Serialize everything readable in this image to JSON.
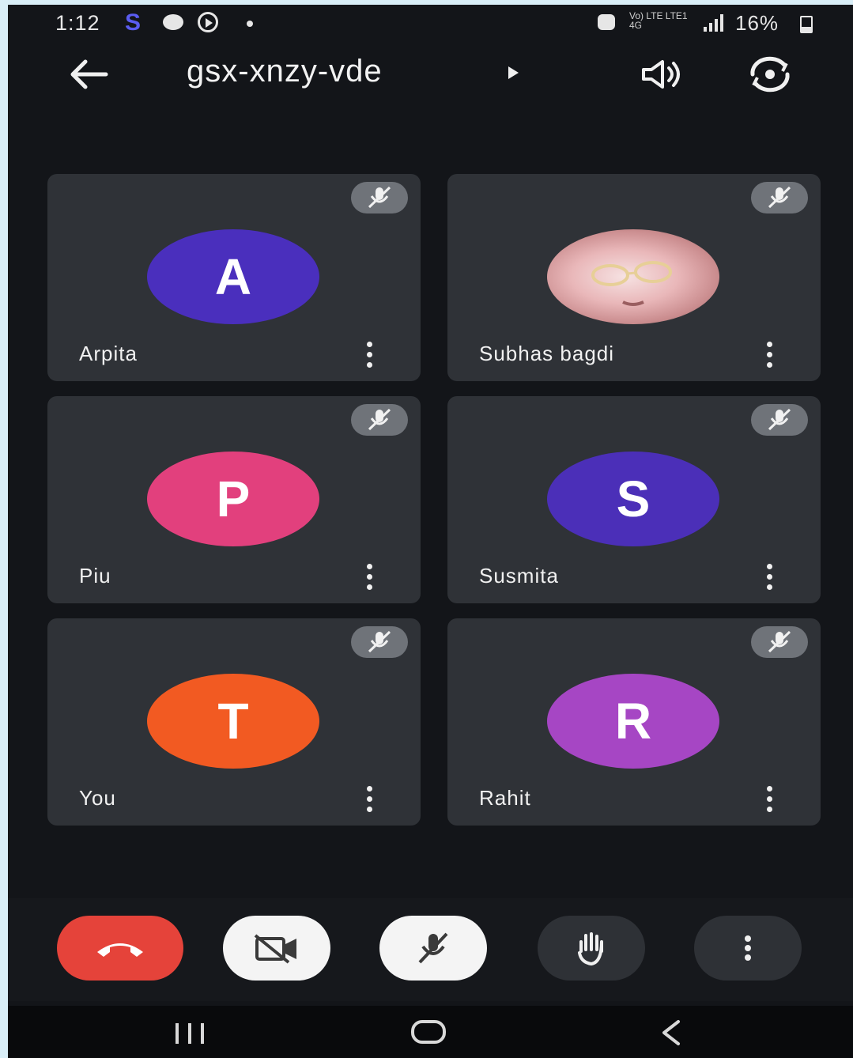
{
  "status_bar": {
    "time": "1:12",
    "app_letter": "S",
    "network_label": "Vo) LTE LTE1 4G",
    "battery_percent": "16%"
  },
  "header": {
    "meeting_code": "gsx-xnzy-vde"
  },
  "participants": [
    {
      "name": "Arpita",
      "initial": "A",
      "color": "#4a2fbd",
      "muted": true
    },
    {
      "name": "Subhas bagdi",
      "initial": "",
      "color": "photo",
      "muted": true
    },
    {
      "name": "Piu",
      "initial": "P",
      "color": "#e2407d",
      "muted": true
    },
    {
      "name": "Susmita",
      "initial": "S",
      "color": "#4b2fb8",
      "muted": true
    },
    {
      "name": "You",
      "initial": "T",
      "color": "#f25a22",
      "muted": true
    },
    {
      "name": "Rahit",
      "initial": "R",
      "color": "#a646c4",
      "muted": true
    }
  ],
  "controls": {
    "end_call_color": "#e5433a",
    "camera": "off",
    "mic": "off"
  },
  "icons": {
    "mute": "mic-off-icon",
    "more": "more-vert-icon",
    "speaker": "speaker-icon",
    "switch_camera": "switch-camera-icon"
  }
}
